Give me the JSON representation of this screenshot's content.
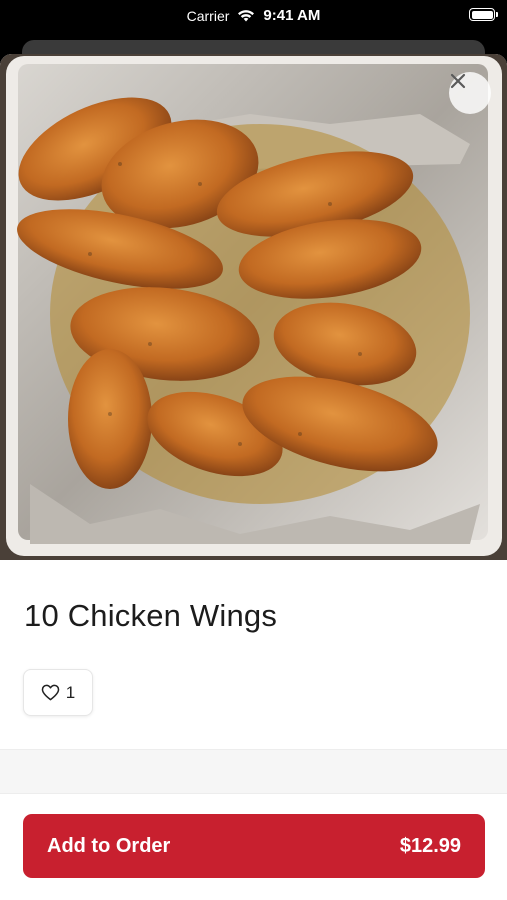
{
  "status_bar": {
    "carrier": "Carrier",
    "time": "9:41 AM"
  },
  "item": {
    "title": "10 Chicken Wings",
    "like_count": "1",
    "price": "$12.99"
  },
  "actions": {
    "add_to_order_label": "Add to Order"
  },
  "colors": {
    "accent": "#c8202f"
  },
  "icons": {
    "close": "close-icon",
    "like": "heart-outline-icon",
    "wifi": "wifi-icon",
    "battery": "battery-icon"
  }
}
